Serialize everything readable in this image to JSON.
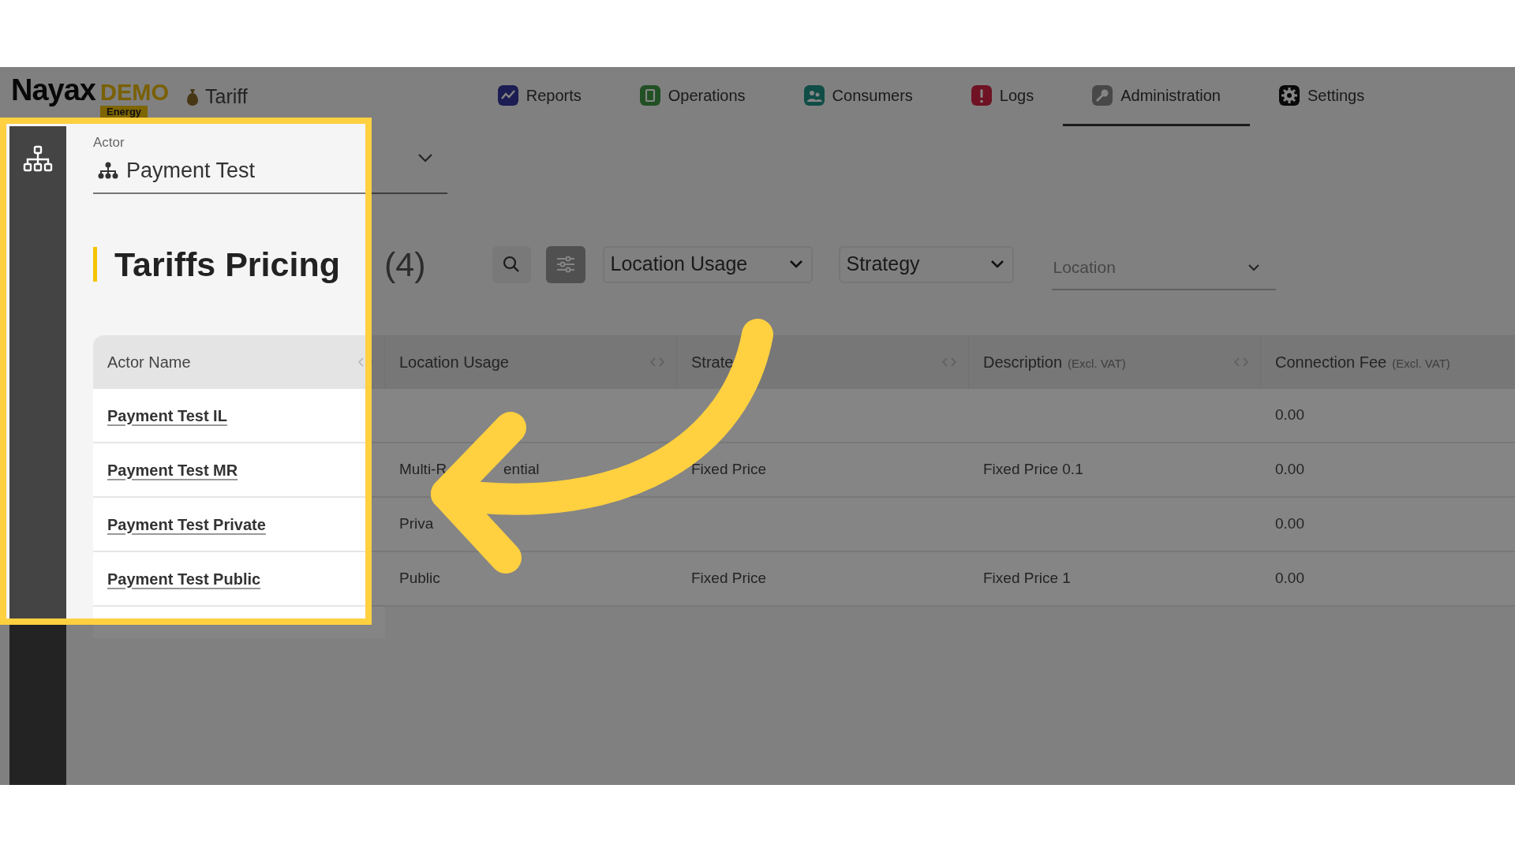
{
  "brand": {
    "name": "Nayax",
    "tag": "DEMO",
    "badge": "Energy"
  },
  "module": "Tariff",
  "nav": [
    {
      "label": "Reports",
      "selected": false,
      "color": "#1c1d52"
    },
    {
      "label": "Operations",
      "selected": false,
      "color": "#215024"
    },
    {
      "label": "Consumers",
      "selected": false,
      "color": "#104d47"
    },
    {
      "label": "Logs",
      "selected": false,
      "color": "#6f1324"
    },
    {
      "label": "Administration",
      "selected": true,
      "color": "#484848"
    },
    {
      "label": "Settings",
      "selected": false,
      "color": "#090909"
    }
  ],
  "actor": {
    "label": "Actor",
    "value": "Payment Test"
  },
  "title": "Tariffs Pricing",
  "count": "(4)",
  "filters": [
    {
      "kind": "select",
      "value": "Location Usage"
    },
    {
      "kind": "select",
      "value": "Strategy"
    },
    {
      "kind": "underline",
      "placeholder": "Location"
    }
  ],
  "table": {
    "columns": [
      {
        "label": "Actor Name",
        "sortable": true
      },
      {
        "label": "Location Usage",
        "sortable": true
      },
      {
        "label": "Strate",
        "sortable": true
      },
      {
        "label": "Description",
        "note": "(Excl. VAT)",
        "sortable": true
      },
      {
        "label": "Connection Fee",
        "note": "(Excl. VAT)",
        "sortable": false
      }
    ],
    "rows": [
      {
        "actor_name": "Payment Test IL",
        "location_usage": [],
        "connection_fee": "0.00"
      },
      {
        "actor_name": "Payment Test MR",
        "location_usage": [
          "Multi-R",
          "ential"
        ],
        "strategy": "Fixed Price",
        "description": "Fixed Price 0.1",
        "connection_fee": "0.00"
      },
      {
        "actor_name": "Payment Test Private",
        "location_usage": [
          "Priva"
        ],
        "connection_fee": "0.00"
      },
      {
        "actor_name": "Payment Test Public",
        "location_usage": [
          "Public"
        ],
        "strategy": "Fixed Price",
        "description": "Fixed Price 1",
        "connection_fee": "0.00"
      }
    ]
  }
}
